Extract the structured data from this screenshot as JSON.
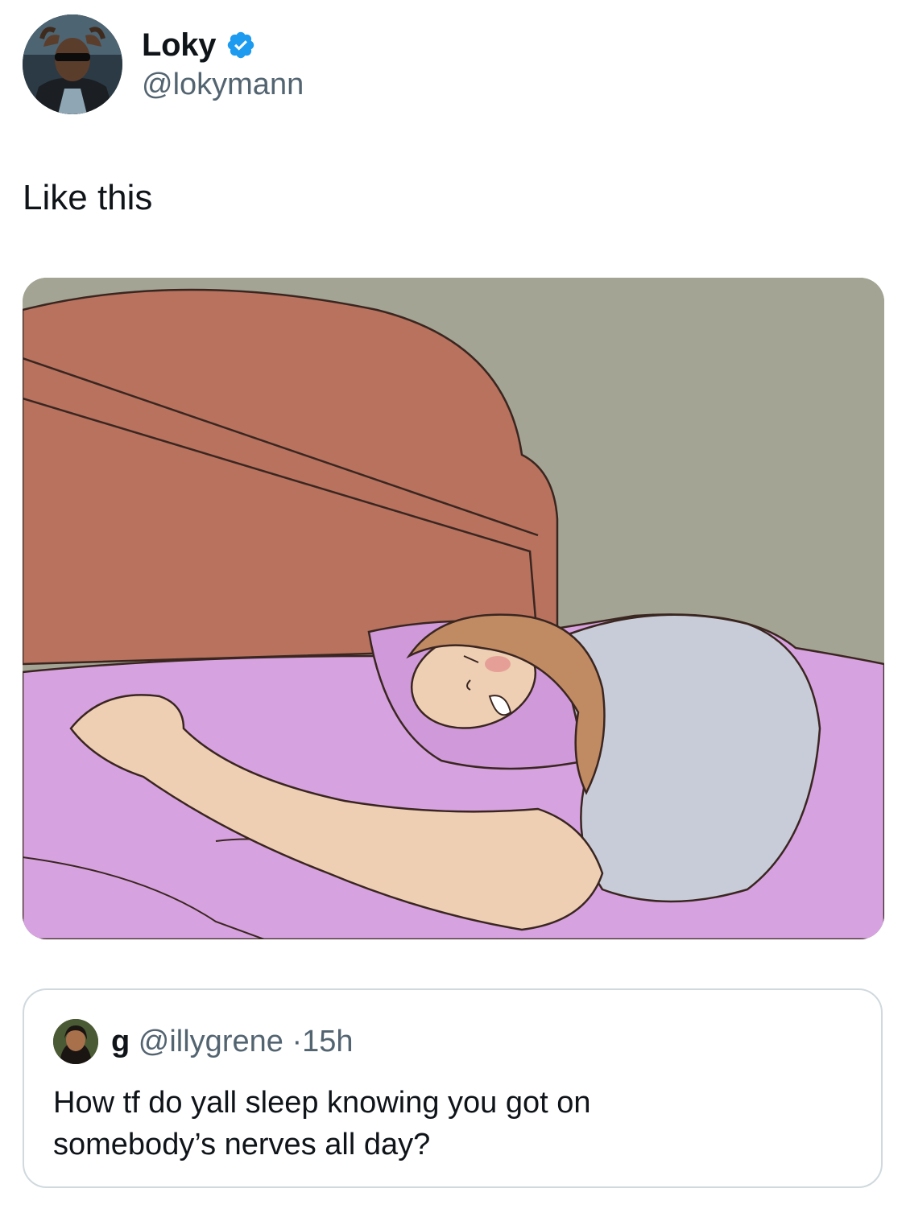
{
  "author": {
    "display_name": "Loky",
    "handle": "@lokymann",
    "verified": true,
    "avatar_icon": "profile-photo"
  },
  "tweet": {
    "text": "Like this"
  },
  "media": {
    "icon": "cartoon-sleeping-person-image",
    "colors": {
      "wall": "#a3a493",
      "headboard": "#b8725e",
      "sheets": "#d6a2e0",
      "shirt": "#c8ccd8",
      "skin": "#eecfb4",
      "hair": "#c08a63"
    }
  },
  "quoted_tweet": {
    "display_name": "g",
    "handle": "@illygrene",
    "separator": "·",
    "time": "15h",
    "text_line1": "How tf do yall sleep knowing you got on",
    "text_line2": "somebody’s nerves all day?"
  },
  "colors": {
    "verified_badge": "#1d9bf0",
    "secondary_text": "#536471",
    "border": "#cfd9de"
  }
}
